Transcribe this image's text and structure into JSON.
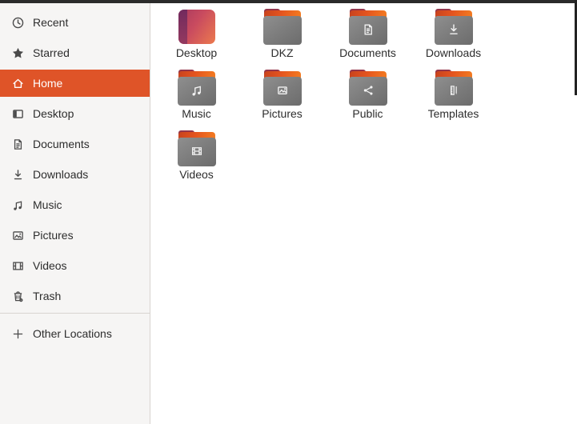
{
  "colors": {
    "accent_orange": "#DF5428",
    "topbar": "#2B2B2B",
    "sidebar_bg": "#F6F5F4",
    "sidebar_border": "#D8D4D0",
    "text": "#2D2D2D",
    "selected_text": "#FFFFFF",
    "icon_gray": "#4A4A4A",
    "emblem_white": "#F2F2F2"
  },
  "sidebar": {
    "items": [
      {
        "label": "Recent",
        "icon": "clock-icon",
        "selected": false
      },
      {
        "label": "Starred",
        "icon": "star-icon",
        "selected": false
      },
      {
        "label": "Home",
        "icon": "home-icon",
        "selected": true
      },
      {
        "label": "Desktop",
        "icon": "desktop-pane-icon",
        "selected": false
      },
      {
        "label": "Documents",
        "icon": "document-icon",
        "selected": false
      },
      {
        "label": "Downloads",
        "icon": "download-icon",
        "selected": false
      },
      {
        "label": "Music",
        "icon": "music-note-icon",
        "selected": false
      },
      {
        "label": "Pictures",
        "icon": "picture-icon",
        "selected": false
      },
      {
        "label": "Videos",
        "icon": "film-icon",
        "selected": false
      },
      {
        "label": "Trash",
        "icon": "trash-icon",
        "selected": false
      }
    ],
    "bottom_item": {
      "label": "Other Locations",
      "icon": "plus-icon"
    }
  },
  "files": {
    "view": "icon-grid",
    "items": [
      {
        "name": "Desktop",
        "icon": "desktop-special",
        "emblem": null
      },
      {
        "name": "DKZ",
        "icon": "folder",
        "emblem": null
      },
      {
        "name": "Documents",
        "icon": "folder",
        "emblem": "document-emblem"
      },
      {
        "name": "Downloads",
        "icon": "folder",
        "emblem": "download-emblem"
      },
      {
        "name": "Music",
        "icon": "folder",
        "emblem": "music-emblem"
      },
      {
        "name": "Pictures",
        "icon": "folder",
        "emblem": "picture-emblem"
      },
      {
        "name": "Public",
        "icon": "folder",
        "emblem": "share-emblem"
      },
      {
        "name": "Templates",
        "icon": "folder",
        "emblem": "templates-emblem"
      },
      {
        "name": "Videos",
        "icon": "folder",
        "emblem": "video-emblem"
      }
    ]
  }
}
